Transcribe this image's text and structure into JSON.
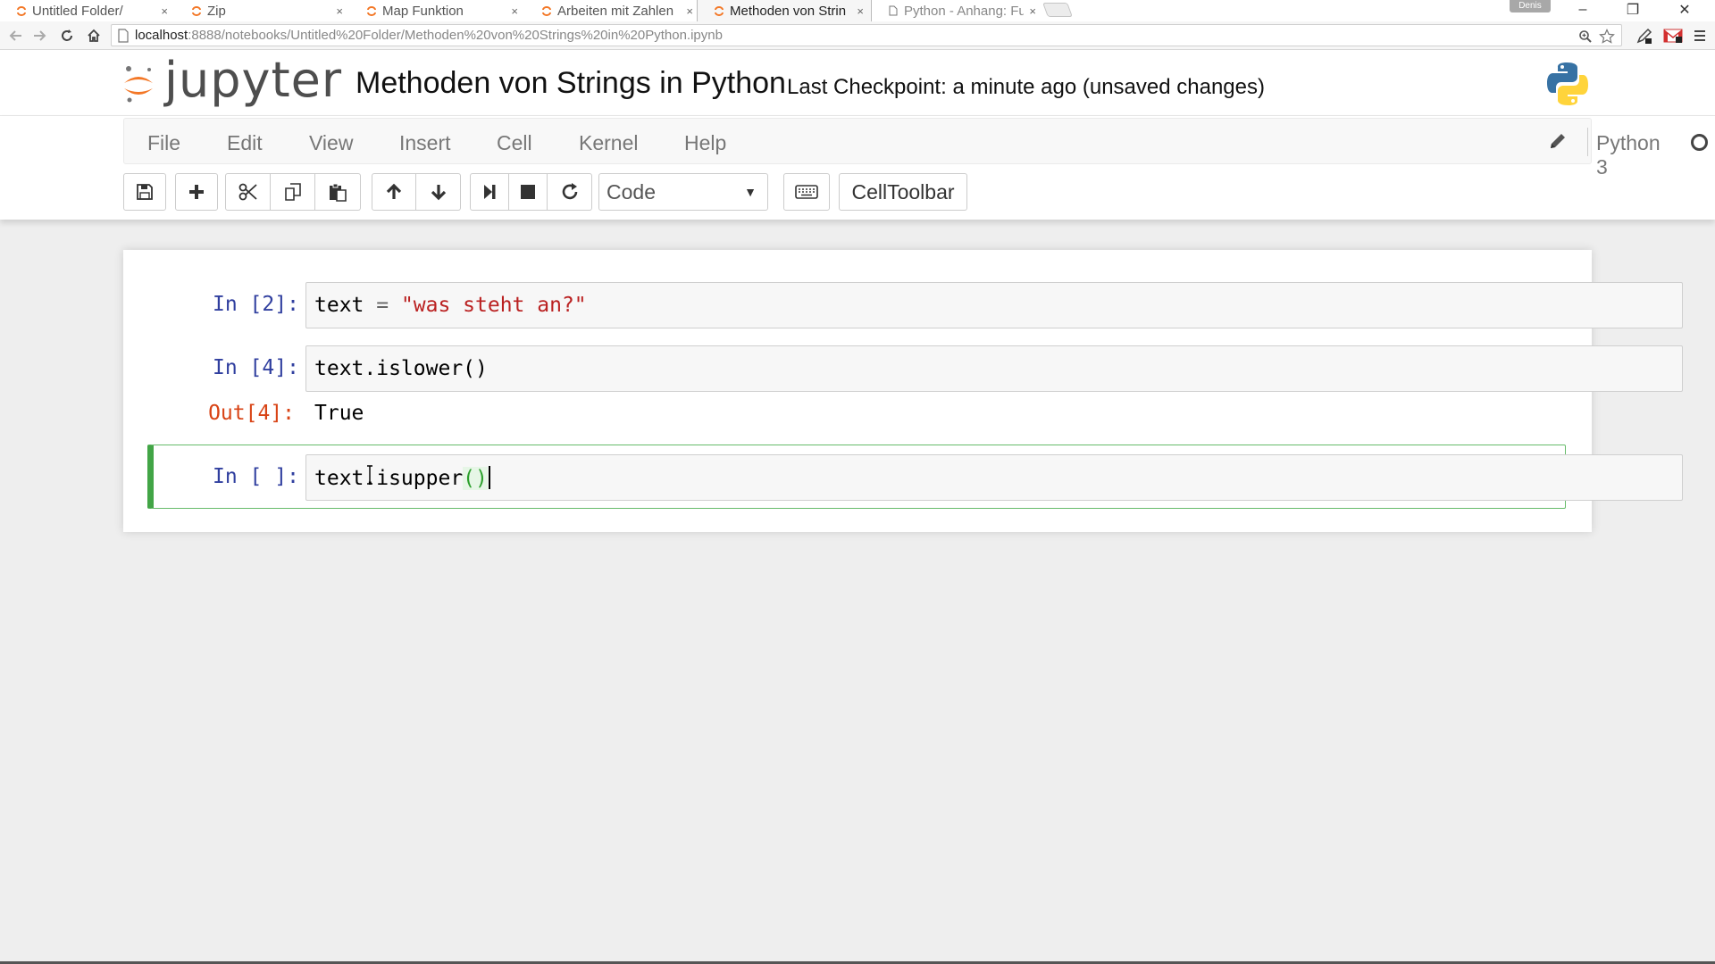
{
  "browser": {
    "tabs": [
      {
        "label": "Untitled Folder/",
        "active": false
      },
      {
        "label": "Zip",
        "active": false
      },
      {
        "label": "Map Funktion",
        "active": false
      },
      {
        "label": "Arbeiten mit Zahlen",
        "active": false
      },
      {
        "label": "Methoden von Strin",
        "active": true
      },
      {
        "label": "Python - Anhang: Fu",
        "active": false
      }
    ],
    "tab_close": "×",
    "profile_name": "Denis",
    "window_controls": {
      "minimize": "–",
      "restore": "❐",
      "close": "✕"
    },
    "address": {
      "host": "localhost",
      "path": ":8888/notebooks/Untitled%20Folder/Methoden%20von%20Strings%20in%20Python.ipynb"
    }
  },
  "header": {
    "logo_text": "jupyter",
    "notebook_title": "Methoden von Strings in Python",
    "checkpoint": "Last Checkpoint: a minute ago (unsaved changes)"
  },
  "menu": {
    "items": [
      "File",
      "Edit",
      "View",
      "Insert",
      "Cell",
      "Kernel",
      "Help"
    ],
    "kernel_name": "Python 3"
  },
  "toolbar": {
    "cell_type": "Code",
    "celltoolbar_label": "CellToolbar"
  },
  "cells": [
    {
      "prompt": "In [2]:",
      "code_var": "text",
      "code_op": " = ",
      "code_str": "\"was steht an?\""
    },
    {
      "prompt": "In [4]:",
      "code": "text.islower()",
      "out_prompt": "Out[4]:",
      "output": "True"
    },
    {
      "prompt": "In [ ]:",
      "code_before": "text.isupper",
      "code_parens": "()",
      "selected": true
    }
  ],
  "colors": {
    "in_prompt": "#303f9f",
    "out_prompt": "#d84315",
    "string_literal": "#ba2121",
    "selected_cell_border": "#42a546",
    "jupyter_orange": "#f37726"
  }
}
